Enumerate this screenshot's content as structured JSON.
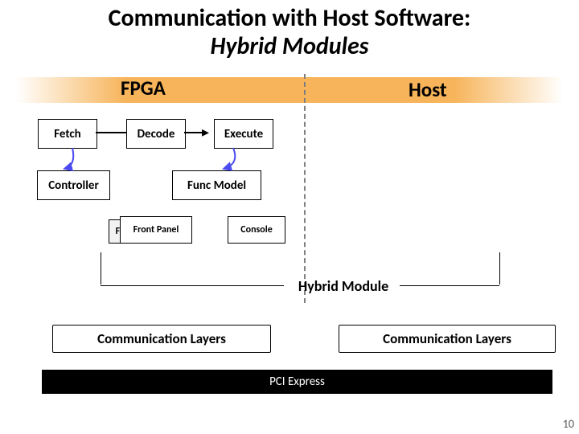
{
  "title": {
    "line1": "Communication with Host Software:",
    "line2": "Hybrid Modules"
  },
  "header": {
    "fpga": "FPGA",
    "host": "Host"
  },
  "pipeline": {
    "fetch": "Fetch",
    "decode": "Decode",
    "execute": "Execute",
    "controller": "Controller",
    "func_model": "Func Model"
  },
  "small": {
    "fr": "Fr",
    "front_panel": "Front Panel",
    "console": "Console"
  },
  "hybrid_module_label": "Hybrid Module",
  "comm_layers_left": "Communication Layers",
  "comm_layers_right": "Communication Layers",
  "bus": "PCI Express",
  "page_number": "10",
  "colors": {
    "band": "#f7b45a",
    "bus_bg": "#000000",
    "bus_fg": "#ffffff"
  }
}
